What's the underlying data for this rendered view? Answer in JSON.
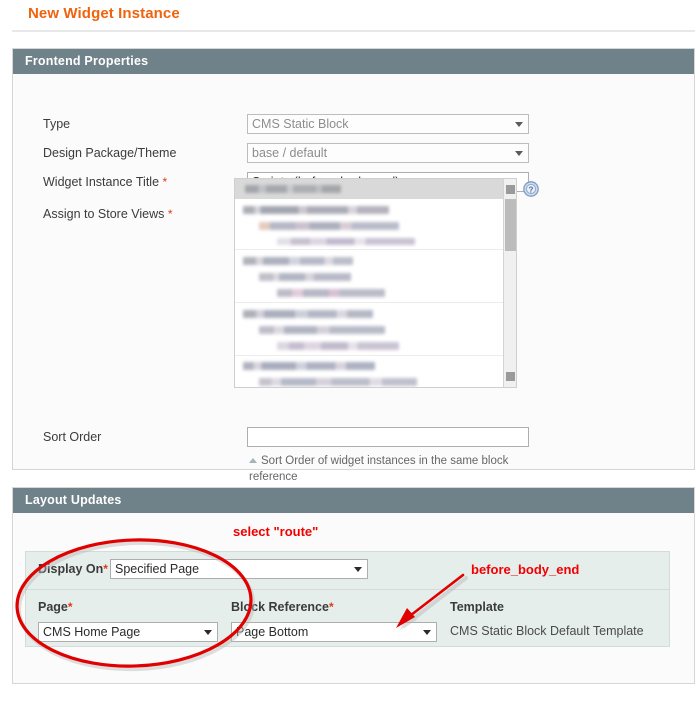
{
  "page": {
    "title": "New Widget Instance"
  },
  "frontend_panel": {
    "header": "Frontend Properties",
    "fields": {
      "type": {
        "label": "Type",
        "value": "CMS Static Block",
        "disabled": true
      },
      "design": {
        "label": "Design Package/Theme",
        "value": "base / default",
        "disabled": true
      },
      "title": {
        "label": "Widget Instance Title",
        "required": "*",
        "value": "Scripts (before_body_end)",
        "placeholder": ""
      },
      "store_views": {
        "label": "Assign to Store Views",
        "required": "*",
        "header_option": "All Store Views",
        "options_redacted": true
      },
      "sort_order": {
        "label": "Sort Order",
        "value": "",
        "placeholder": "",
        "note": "Sort Order of widget instances in the same block reference"
      }
    },
    "help_icon": "help-question-icon"
  },
  "layout_panel": {
    "header": "Layout Updates",
    "display_on": {
      "label": "Display On",
      "required": "*",
      "value": "Specified Page"
    },
    "page": {
      "label": "Page",
      "required": "*",
      "value": "CMS Home Page"
    },
    "block_reference": {
      "label": "Block Reference",
      "required": "*",
      "value": "Page Bottom"
    },
    "template": {
      "label": "Template",
      "value": "CMS Static Block Default Template"
    }
  },
  "annotations": {
    "route": "select \"route\"",
    "before_body_end": "before_body_end",
    "color": "#f20000"
  },
  "colors": {
    "title": "#f1620d",
    "panel_header_bg": "#6f8189",
    "layout_inner_bg": "#e6eeec",
    "required_star": "#dc3a1b",
    "annotation": "#f20000"
  }
}
